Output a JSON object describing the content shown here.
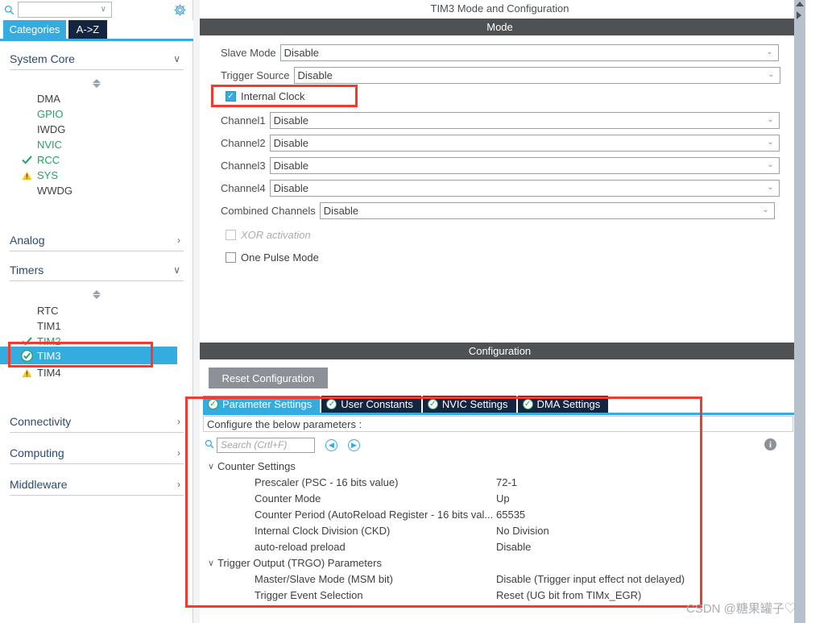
{
  "left_panel": {
    "search": {
      "value": "",
      "placeholder": "",
      "icon": "search-icon",
      "caret": "∨"
    },
    "gear_icon": "gear-icon",
    "tabs": [
      {
        "label": "Categories",
        "selected": true
      },
      {
        "label": "A->Z",
        "selected": false
      }
    ],
    "groups": [
      {
        "title": "System Core",
        "expanded": true,
        "chevron": "∨",
        "items": [
          {
            "label": "DMA",
            "status": "none",
            "color": "grey"
          },
          {
            "label": "GPIO",
            "status": "none",
            "color": "green"
          },
          {
            "label": "IWDG",
            "status": "none",
            "color": "grey"
          },
          {
            "label": "NVIC",
            "status": "none",
            "color": "green"
          },
          {
            "label": "RCC",
            "status": "check",
            "color": "green"
          },
          {
            "label": "SYS",
            "status": "warning",
            "color": "green"
          },
          {
            "label": "WWDG",
            "status": "none",
            "color": "grey"
          }
        ]
      },
      {
        "title": "Analog",
        "expanded": false,
        "chevron": "›",
        "items": []
      },
      {
        "title": "Timers",
        "expanded": true,
        "chevron": "∨",
        "items": [
          {
            "label": "RTC",
            "status": "none",
            "color": "grey"
          },
          {
            "label": "TIM1",
            "status": "none",
            "color": "grey"
          },
          {
            "label": "TIM2",
            "status": "check",
            "color": "green"
          },
          {
            "label": "TIM3",
            "status": "check",
            "color": "white",
            "selected": true
          },
          {
            "label": "TIM4",
            "status": "warning",
            "color": "grey"
          }
        ]
      },
      {
        "title": "Connectivity",
        "expanded": false,
        "chevron": "›",
        "items": []
      },
      {
        "title": "Computing",
        "expanded": false,
        "chevron": "›",
        "items": []
      },
      {
        "title": "Middleware",
        "expanded": false,
        "chevron": "›",
        "items": []
      }
    ]
  },
  "right_panel": {
    "title": "TIM3 Mode and Configuration",
    "mode_header": "Mode",
    "config_header": "Configuration",
    "mode": {
      "combos": [
        {
          "label": "Slave Mode",
          "value": "Disable"
        },
        {
          "label": "Trigger Source",
          "value": "Disable"
        },
        {
          "label": "Channel1",
          "value": "Disable"
        },
        {
          "label": "Channel2",
          "value": "Disable"
        },
        {
          "label": "Channel3",
          "value": "Disable"
        },
        {
          "label": "Channel4",
          "value": "Disable"
        },
        {
          "label": "Combined Channels",
          "value": "Disable"
        }
      ],
      "checkboxes": [
        {
          "label": "Internal Clock",
          "checked": true,
          "disabled": false
        },
        {
          "label": "XOR activation",
          "checked": false,
          "disabled": true
        },
        {
          "label": "One Pulse Mode",
          "checked": false,
          "disabled": false
        }
      ]
    },
    "configuration": {
      "reset_button": "Reset Configuration",
      "tabs": [
        {
          "label": "Parameter Settings",
          "selected": true,
          "icon": "shield-check-icon"
        },
        {
          "label": "User Constants",
          "selected": false,
          "icon": "shield-check-icon"
        },
        {
          "label": "NVIC Settings",
          "selected": false,
          "icon": "shield-check-icon"
        },
        {
          "label": "DMA Settings",
          "selected": false,
          "icon": "shield-check-icon"
        }
      ],
      "note": "Configure the below parameters :",
      "search_placeholder": "Search (Crtl+F)",
      "search_value": "",
      "prev_icon": "chevron-left-circle-icon",
      "next_icon": "chevron-right-circle-icon",
      "info_icon": "info-icon",
      "tree": [
        {
          "group": "Counter Settings",
          "chevron": "∨",
          "rows": [
            {
              "name": "Prescaler (PSC - 16 bits value)",
              "value": "72-1"
            },
            {
              "name": "Counter Mode",
              "value": "Up"
            },
            {
              "name": "Counter Period (AutoReload Register - 16 bits val...",
              "value": "65535"
            },
            {
              "name": "Internal Clock Division (CKD)",
              "value": "No Division"
            },
            {
              "name": "auto-reload preload",
              "value": "Disable"
            }
          ]
        },
        {
          "group": "Trigger Output (TRGO) Parameters",
          "chevron": "∨",
          "rows": [
            {
              "name": "Master/Slave Mode (MSM bit)",
              "value": "Disable (Trigger input effect not delayed)"
            },
            {
              "name": "Trigger Event Selection",
              "value": "Reset (UG bit from TIMx_EGR)"
            }
          ]
        }
      ]
    }
  },
  "watermark": "CSDN @糖果罐子♡",
  "colors": {
    "accent_blue": "#35ace0",
    "dark_navy": "#13253f",
    "header_gray": "#4e5254",
    "annotation_red": "#f23a2e",
    "status_green": "#21a366",
    "warning_yellow": "#f5c518"
  }
}
